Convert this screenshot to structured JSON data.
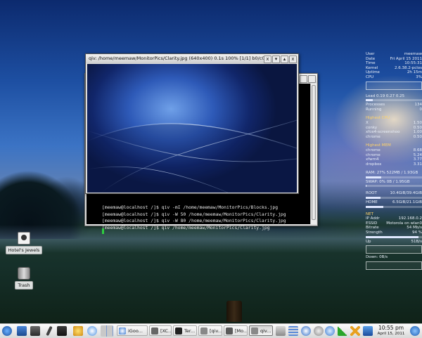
{
  "desktop": {
    "icons": [
      {
        "label": "Hotel's Jewels"
      },
      {
        "label": "Trash"
      }
    ]
  },
  "qiv_window": {
    "title": "qiv: /home/meemaw/MonitorPics/Clarity.jpg (640x400) 0.1s 100% [1/1] b0/c0...",
    "buttons": [
      "x",
      "▾",
      "▴",
      "x"
    ]
  },
  "terminal": {
    "lines": [
      "[meemaw@localhost /]$ qiv -mI /home/meemaw/MonitorPics/Blocks.jpg",
      "[meemaw@localhost /]$ qiv -W 50 /home/meemaw/MonitorPics/Clarity.jpg",
      "[meemaw@localhost /]$ qiv -W 80 /home/meemaw/MonitorPics/Clarity.jpg",
      "[meemaw@localhost /]$ qiv /home/meemaw/MonitorPics/Clarity.jpg"
    ]
  },
  "conky": {
    "system": [
      {
        "k": "User",
        "v": "meemaw"
      },
      {
        "k": "Date",
        "v": "Fri April 15 2011"
      },
      {
        "k": "Time",
        "v": "10:55:31"
      },
      {
        "k": "Kernel",
        "v": "2.6.38.2-pclos"
      },
      {
        "k": "Uptime",
        "v": "2h 15m"
      },
      {
        "k": "CPU",
        "v": "3%"
      }
    ],
    "load_label": "Load 0.19 0.27 0.25",
    "cpu_bar": 0.12,
    "procs": [
      {
        "k": "Processes",
        "v": "134"
      },
      {
        "k": "Running",
        "v": "0"
      }
    ],
    "highest_cpu_title": "Highest CPU",
    "highest_cpu": [
      {
        "k": "X",
        "v": "1.50"
      },
      {
        "k": "conky",
        "v": "0.50"
      },
      {
        "k": "xfce4-screenshoo",
        "v": "1.00"
      },
      {
        "k": "chrome",
        "v": "0.50"
      }
    ],
    "highest_mem_title": "Highest MEM",
    "highest_mem": [
      {
        "k": "chrome",
        "v": "8.68"
      },
      {
        "k": "chrome",
        "v": "5.24"
      },
      {
        "k": "xfwm4",
        "v": "3.77"
      },
      {
        "k": "dropbox",
        "v": "3.31"
      }
    ],
    "ram_label": "RAM: 27% 522MB / 1.93GB",
    "ram_bar": 0.27,
    "swap_label": "SWAP: 0% 0B / 1.95GB",
    "swap_bar": 0.01,
    "disks": [
      {
        "k": "ROOT",
        "v": "10.4GiB/39.4GiB",
        "fill": 0.26
      },
      {
        "k": "HOME",
        "v": "6.5GiB/21.1GiB",
        "fill": 0.31
      }
    ],
    "net_title": "NET",
    "net": [
      {
        "k": "IP Addr",
        "v": "192.168.0.2"
      },
      {
        "k": "ESSID",
        "v": "Motorola on wlan0"
      },
      {
        "k": "Bitrate",
        "v": "54 Mb/s"
      },
      {
        "k": "Strength",
        "v": "94 %"
      },
      {
        "k": "Up",
        "v": "51B/s"
      }
    ],
    "wifi_bar": 0.94,
    "down_label": "Down: 0B/s"
  },
  "taskbar": {
    "tasks": [
      {
        "label": "iGoo..."
      },
      {
        "label": "[XC..."
      },
      {
        "label": "Ter..."
      },
      {
        "label": "[qiv..."
      },
      {
        "label": "[Mo..."
      },
      {
        "label": "qiv..."
      }
    ],
    "clock_time": "10:55 pm",
    "clock_date": "April 15, 2011",
    "colors": {
      "accent": "#2b5fb4",
      "terminal_bg": "#000000",
      "cursor": "#2ecc40"
    }
  }
}
